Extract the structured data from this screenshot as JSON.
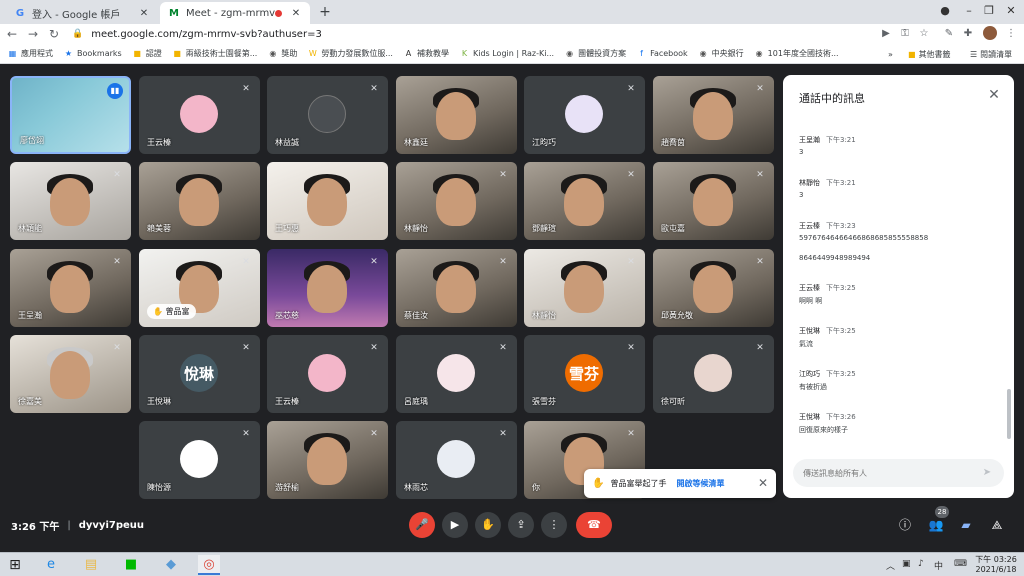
{
  "browser": {
    "tabs": [
      {
        "title": "登入 - Google 帳戶",
        "favicon": "G",
        "active": false
      },
      {
        "title": "Meet - zgm-mrmv-svb",
        "favicon": "M",
        "active": true
      }
    ],
    "new_tab": "+",
    "url": "meet.google.com/zgm-mrmv-svb?authuser=3",
    "bookmarks": [
      {
        "label": "應用程式",
        "icon": "apps-icon"
      },
      {
        "label": "Bookmarks",
        "icon": "star-icon"
      },
      {
        "label": "認證",
        "icon": "folder-icon"
      },
      {
        "label": "兩級技術士園餐第...",
        "icon": "folder-icon"
      },
      {
        "label": "獎助",
        "icon": "globe-icon"
      },
      {
        "label": "勞動力發展數位服...",
        "icon": "w-icon"
      },
      {
        "label": "補救教學",
        "icon": "a-icon"
      },
      {
        "label": "Kids Login | Raz-Ki...",
        "icon": "k-icon"
      },
      {
        "label": "團體投資方案",
        "icon": "globe-icon"
      },
      {
        "label": "Facebook",
        "icon": "facebook-icon"
      },
      {
        "label": "中央銀行",
        "icon": "globe-icon"
      },
      {
        "label": "101年度全國技術...",
        "icon": "globe-icon"
      }
    ],
    "bookmarks_more": "»",
    "other_bookmarks": "其他書籤",
    "reading_list": "閱讀清單"
  },
  "meet": {
    "tiles": [
      {
        "name": "廖岱翊",
        "type": "self"
      },
      {
        "name": "王云榛",
        "type": "avatar",
        "color": "#f3b6c9",
        "initial": ""
      },
      {
        "name": "林益誠",
        "type": "avatar",
        "color": "#4a4e52",
        "initial": ""
      },
      {
        "name": "林鑫廷",
        "type": "video"
      },
      {
        "name": "江昀巧",
        "type": "avatar",
        "color": "#e8e2f7",
        "initial": ""
      },
      {
        "name": "趙喬茵",
        "type": "video"
      },
      {
        "name": "林穎能",
        "type": "video"
      },
      {
        "name": "賴美蓉",
        "type": "video"
      },
      {
        "name": "王巧惠",
        "type": "video"
      },
      {
        "name": "林靜怡",
        "type": "video"
      },
      {
        "name": "鄧靜瑄",
        "type": "video"
      },
      {
        "name": "歐屯嘉",
        "type": "video"
      },
      {
        "name": "王呈瀚",
        "type": "video"
      },
      {
        "name": "曾品富",
        "type": "video",
        "hand": true
      },
      {
        "name": "巫芯慈",
        "type": "video"
      },
      {
        "name": "蔡佳汝",
        "type": "video"
      },
      {
        "name": "林靜怡",
        "type": "video"
      },
      {
        "name": "邱黃允敬",
        "type": "video"
      },
      {
        "name": "徐嘉美",
        "type": "video"
      },
      {
        "name": "王悅琳",
        "type": "avatar",
        "color": "#455a64",
        "initial": "悅琳"
      },
      {
        "name": "王云榛",
        "type": "avatar",
        "color": "#f3b6c9",
        "initial": ""
      },
      {
        "name": "呂庭瑀",
        "type": "avatar",
        "color": "#f6e5e9",
        "initial": ""
      },
      {
        "name": "張雪芬",
        "type": "avatar",
        "color": "#ef6c00",
        "initial": "雪芬"
      },
      {
        "name": "徐可昕",
        "type": "avatar",
        "color": "#e8d6cf",
        "initial": ""
      },
      {
        "name": "陳怡源",
        "type": "avatar",
        "color": "#ffffff",
        "initial": ""
      },
      {
        "name": "游舒榆",
        "type": "video"
      },
      {
        "name": "林雨芯",
        "type": "avatar",
        "color": "#e9edf3",
        "initial": ""
      },
      {
        "name": "你",
        "type": "video"
      }
    ],
    "hand_chip": "曾品富",
    "meeting_time": "3:26 下午",
    "meeting_code": "dyvyi7peuu",
    "participant_count": "28",
    "chat": {
      "title": "通話中的訊息",
      "messages": [
        {
          "sender": "王呈瀚",
          "time": "下午3:21",
          "text": "3"
        },
        {
          "sender": "林靜怡",
          "time": "下午3:21",
          "text": "3"
        },
        {
          "sender": "王云榛",
          "time": "下午3:23",
          "text": "59767646466466868685855558858"
        },
        {
          "sender": "",
          "time": "",
          "text": "8646449948989494"
        },
        {
          "sender": "王云榛",
          "time": "下午3:25",
          "text": "啊啊 啊"
        },
        {
          "sender": "王悅琳",
          "time": "下午3:25",
          "text": "氣流"
        },
        {
          "sender": "江昀巧",
          "time": "下午3:25",
          "text": "有被折過"
        },
        {
          "sender": "王悅琳",
          "time": "下午3:26",
          "text": "回復原來的樣子"
        }
      ],
      "input_placeholder": "傳送訊息給所有人"
    },
    "toast": {
      "message": "曾品富舉起了手",
      "action": "開啟等候清單"
    }
  },
  "taskbar": {
    "time": "下午 03:26",
    "date": "2021/6/18"
  }
}
